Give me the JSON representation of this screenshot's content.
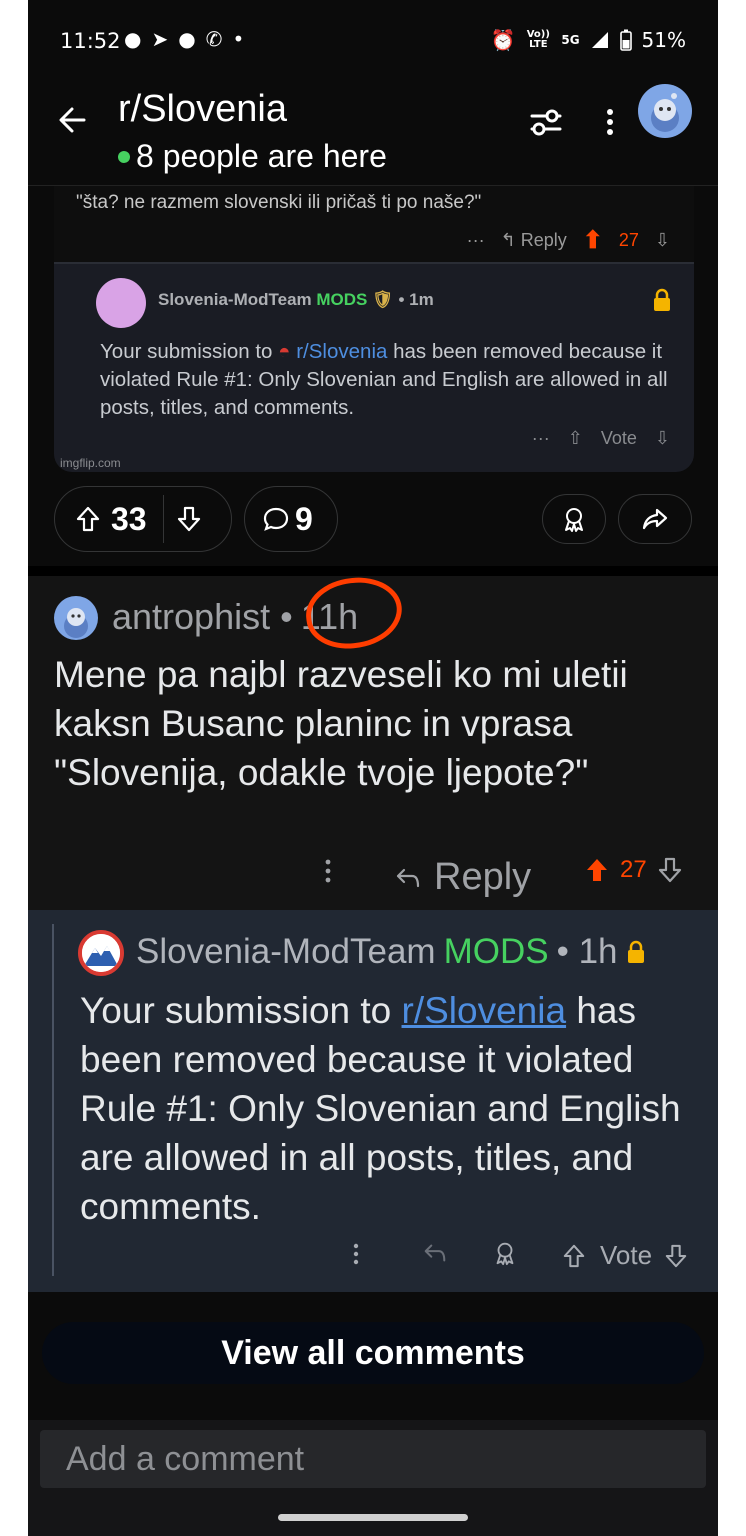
{
  "status_bar": {
    "time": "11:52",
    "network_top": "Vo)) LTE",
    "network_5g": "5G",
    "battery": "51%"
  },
  "header": {
    "title": "r/Slovenia",
    "online_text": "8 people are here"
  },
  "embedded_image": {
    "quote": "\"šta? ne razmem slovenski ili pričaš ti po naše?\"",
    "reply_label": "Reply",
    "vote_count": "27",
    "mod_name": "Slovenia-ModTeam",
    "mod_badge": "MODS",
    "mod_time": "• 1m",
    "text_before": "Your submission to ",
    "text_link": "r/Slovenia",
    "text_after": " has been removed because it violated Rule #1: Only Slovenian and English are allowed in all posts, titles, and comments.",
    "vote_label": "Vote",
    "watermark": "imgflip.com"
  },
  "post_actions": {
    "score": "33",
    "comments": "9"
  },
  "comment": {
    "author": "antrophist",
    "separator": "•",
    "time": "11h",
    "body": "Mene pa najbl razveseli ko mi uletii kaksn Busanc planinc in vprasa \"Slovenija, odakle tvoje ljepote?\"",
    "reply_label": "Reply",
    "score": "27"
  },
  "mod_reply": {
    "author": "Slovenia-ModTeam",
    "badge": "MODS",
    "time": "• 1h",
    "text_before": "Your submission to ",
    "text_link": "r/Slovenia",
    "text_after": " has been removed because it violated Rule #1: Only Slovenian and English are allowed in all posts, titles, and comments.",
    "vote_label": "Vote"
  },
  "view_all": "View all comments",
  "composer": {
    "placeholder": "Add a comment"
  },
  "colors": {
    "upvote": "#ff4500",
    "mods": "#46d160",
    "link": "#4e8ee0",
    "annotation": "#ff3d00"
  }
}
